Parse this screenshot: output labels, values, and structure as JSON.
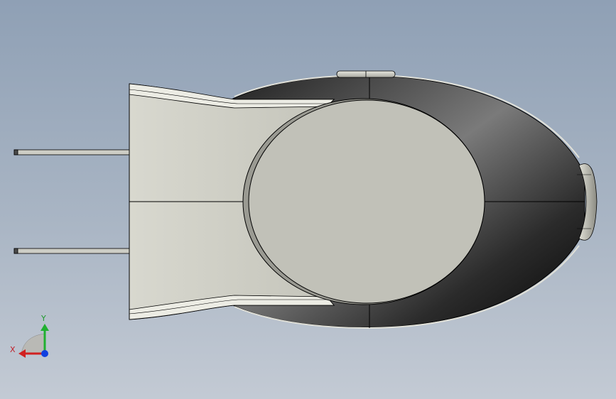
{
  "viewport": {
    "colors": {
      "background_top": "#8fa0b5",
      "background_bottom": "#c3cad4",
      "face_light": "#c8c8bf",
      "face_dark": "#1a1a1a",
      "edge": "#000000"
    }
  },
  "model": {
    "parts": [
      "pin-upper",
      "pin-lower",
      "flared-neck",
      "shell-body",
      "front-disc",
      "top-tab",
      "nose-tab"
    ]
  },
  "triad": {
    "x_label": "X",
    "y_label": "Y",
    "colors": {
      "x": "#d02020",
      "y": "#20b030",
      "z": "#1040e0"
    }
  }
}
